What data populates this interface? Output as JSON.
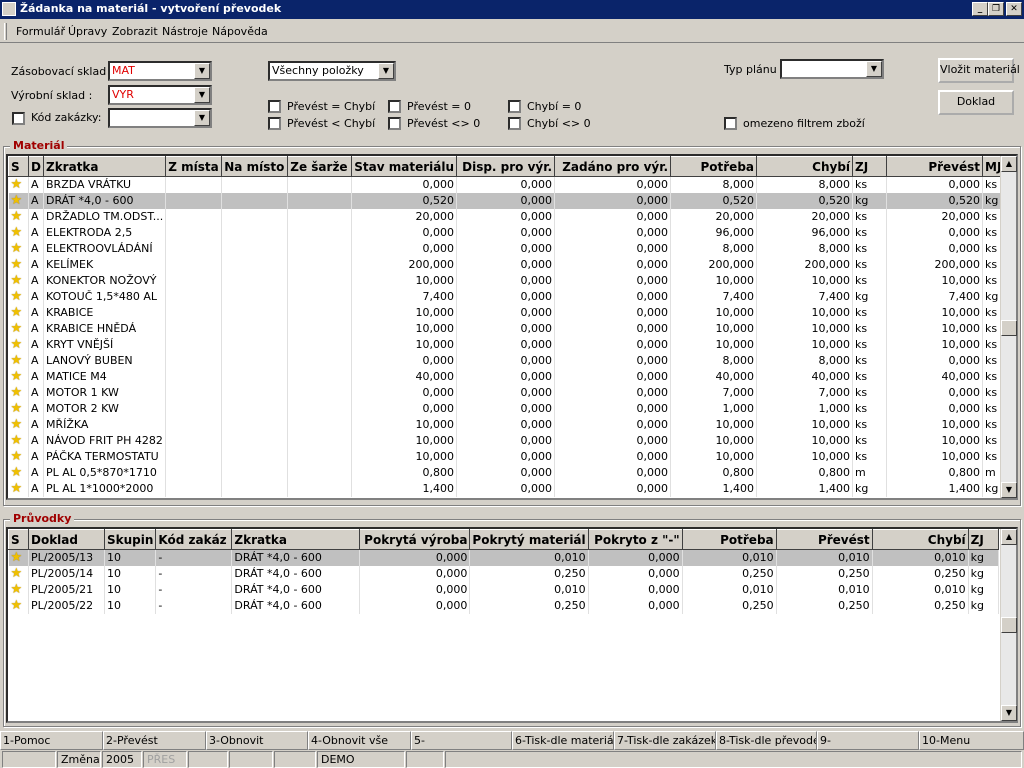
{
  "window": {
    "title": "Žádanka na materiál - vytvoření převodek"
  },
  "menu": [
    "Formulář",
    "Úpravy",
    "Zobrazit",
    "Nástroje",
    "Nápověda"
  ],
  "filters": {
    "zasobovaci_label": "Zásobovací sklad :",
    "zasobovaci_value": "MAT",
    "vyrobni_label": "Výrobní sklad :",
    "vyrobni_value": "VYR",
    "kod_zakazky_label": "Kód zakázky:",
    "kod_zakazky_value": "",
    "polozky_value": "Všechny položky",
    "typ_planu_label": "Typ plánu :",
    "typ_planu_value": "",
    "chk_prevest_eq_chybi": "Převést = Chybí",
    "chk_prevest_lt_chybi": "Převést < Chybí",
    "chk_prevest_eq0": "Převést = 0",
    "chk_prevest_ne0": "Převést <> 0",
    "chk_chybi_eq0": "Chybí = 0",
    "chk_chybi_ne0": "Chybí <> 0",
    "chk_omezeno": "omezeno filtrem zboží"
  },
  "buttons": {
    "vlozit": "Vložit materiál",
    "doklad": "Doklad"
  },
  "material": {
    "title": "Materiál",
    "columns": [
      "S",
      "D",
      "Zkratka",
      "Z místa",
      "Na místo",
      "Ze šarže",
      "Stav materiálu",
      "Disp. pro výr.",
      "Zadáno pro výr.",
      "Potřeba",
      "Chybí",
      "ZJ",
      "Převést",
      "MJ"
    ],
    "rows": [
      [
        "A",
        "BRZDA VRÁTKU",
        "",
        "",
        "",
        "0,000",
        "0,000",
        "0,000",
        "8,000",
        "8,000",
        "ks",
        "0,000",
        "ks"
      ],
      [
        "A",
        "DRÁT *4,0 - 600",
        "",
        "",
        "",
        "0,520",
        "0,000",
        "0,000",
        "0,520",
        "0,520",
        "kg",
        "0,520",
        "kg"
      ],
      [
        "A",
        "DRŽADLO TM.ODST...",
        "",
        "",
        "",
        "20,000",
        "0,000",
        "0,000",
        "20,000",
        "20,000",
        "ks",
        "20,000",
        "ks"
      ],
      [
        "A",
        "ELEKTRODA 2,5",
        "",
        "",
        "",
        "0,000",
        "0,000",
        "0,000",
        "96,000",
        "96,000",
        "ks",
        "0,000",
        "ks"
      ],
      [
        "A",
        "ELEKTROOVLÁDÁNÍ",
        "",
        "",
        "",
        "0,000",
        "0,000",
        "0,000",
        "8,000",
        "8,000",
        "ks",
        "0,000",
        "ks"
      ],
      [
        "A",
        "KELÍMEK",
        "",
        "",
        "",
        "200,000",
        "0,000",
        "0,000",
        "200,000",
        "200,000",
        "ks",
        "200,000",
        "ks"
      ],
      [
        "A",
        "KONEKTOR NOŽOVÝ",
        "",
        "",
        "",
        "10,000",
        "0,000",
        "0,000",
        "10,000",
        "10,000",
        "ks",
        "10,000",
        "ks"
      ],
      [
        "A",
        "KOTOUČ 1,5*480 AL",
        "",
        "",
        "",
        "7,400",
        "0,000",
        "0,000",
        "7,400",
        "7,400",
        "kg",
        "7,400",
        "kg"
      ],
      [
        "A",
        "KRABICE",
        "",
        "",
        "",
        "10,000",
        "0,000",
        "0,000",
        "10,000",
        "10,000",
        "ks",
        "10,000",
        "ks"
      ],
      [
        "A",
        "KRABICE HNĚDÁ",
        "",
        "",
        "",
        "10,000",
        "0,000",
        "0,000",
        "10,000",
        "10,000",
        "ks",
        "10,000",
        "ks"
      ],
      [
        "A",
        "KRYT VNĚJŠÍ",
        "",
        "",
        "",
        "10,000",
        "0,000",
        "0,000",
        "10,000",
        "10,000",
        "ks",
        "10,000",
        "ks"
      ],
      [
        "A",
        "LANOVÝ BUBEN",
        "",
        "",
        "",
        "0,000",
        "0,000",
        "0,000",
        "8,000",
        "8,000",
        "ks",
        "0,000",
        "ks"
      ],
      [
        "A",
        "MATICE M4",
        "",
        "",
        "",
        "40,000",
        "0,000",
        "0,000",
        "40,000",
        "40,000",
        "ks",
        "40,000",
        "ks"
      ],
      [
        "A",
        "MOTOR 1 KW",
        "",
        "",
        "",
        "0,000",
        "0,000",
        "0,000",
        "7,000",
        "7,000",
        "ks",
        "0,000",
        "ks"
      ],
      [
        "A",
        "MOTOR 2 KW",
        "",
        "",
        "",
        "0,000",
        "0,000",
        "0,000",
        "1,000",
        "1,000",
        "ks",
        "0,000",
        "ks"
      ],
      [
        "A",
        "MŘÍŽKA",
        "",
        "",
        "",
        "10,000",
        "0,000",
        "0,000",
        "10,000",
        "10,000",
        "ks",
        "10,000",
        "ks"
      ],
      [
        "A",
        "NÁVOD FRIT PH 4282",
        "",
        "",
        "",
        "10,000",
        "0,000",
        "0,000",
        "10,000",
        "10,000",
        "ks",
        "10,000",
        "ks"
      ],
      [
        "A",
        "PÁČKA TERMOSTATU",
        "",
        "",
        "",
        "10,000",
        "0,000",
        "0,000",
        "10,000",
        "10,000",
        "ks",
        "10,000",
        "ks"
      ],
      [
        "A",
        "PL AL 0,5*870*1710",
        "",
        "",
        "",
        "0,800",
        "0,000",
        "0,000",
        "0,800",
        "0,800",
        "m",
        "0,800",
        "m"
      ],
      [
        "A",
        "PL AL 1*1000*2000",
        "",
        "",
        "",
        "1,400",
        "0,000",
        "0,000",
        "1,400",
        "1,400",
        "kg",
        "1,400",
        "kg"
      ]
    ],
    "selected_row": 1
  },
  "pruvodky": {
    "title": "Průvodky",
    "columns": [
      "S",
      "Doklad",
      "Skupin",
      "Kód zakáz",
      "Zkratka",
      "Pokrytá výroba",
      "Pokrytý materiál",
      "Pokryto z \"-\"",
      "Potřeba",
      "Převést",
      "Chybí",
      "ZJ"
    ],
    "rows": [
      [
        "PL/2005/13",
        "10",
        "-",
        "DRÁT *4,0 - 600",
        "0,000",
        "0,010",
        "0,000",
        "0,010",
        "0,010",
        "0,010",
        "kg"
      ],
      [
        "PL/2005/14",
        "10",
        "-",
        "DRÁT *4,0 - 600",
        "0,000",
        "0,250",
        "0,000",
        "0,250",
        "0,250",
        "0,250",
        "kg"
      ],
      [
        "PL/2005/21",
        "10",
        "-",
        "DRÁT *4,0 - 600",
        "0,000",
        "0,010",
        "0,000",
        "0,010",
        "0,010",
        "0,010",
        "kg"
      ],
      [
        "PL/2005/22",
        "10",
        "-",
        "DRÁT *4,0 - 600",
        "0,000",
        "0,250",
        "0,000",
        "0,250",
        "0,250",
        "0,250",
        "kg"
      ]
    ],
    "selected_row": 0
  },
  "fkeys": [
    "1-Pomoc",
    "2-Převést",
    "3-Obnovit",
    "4-Obnovit vše",
    "5-",
    "6-Tisk-dle materiálu",
    "7-Tisk-dle zakázek",
    "8-Tisk-dle převodek",
    "9-",
    "10-Menu"
  ],
  "status": {
    "mode": "Změna",
    "year": "2005",
    "pres": "PŘES",
    "demo": "DEMO"
  }
}
